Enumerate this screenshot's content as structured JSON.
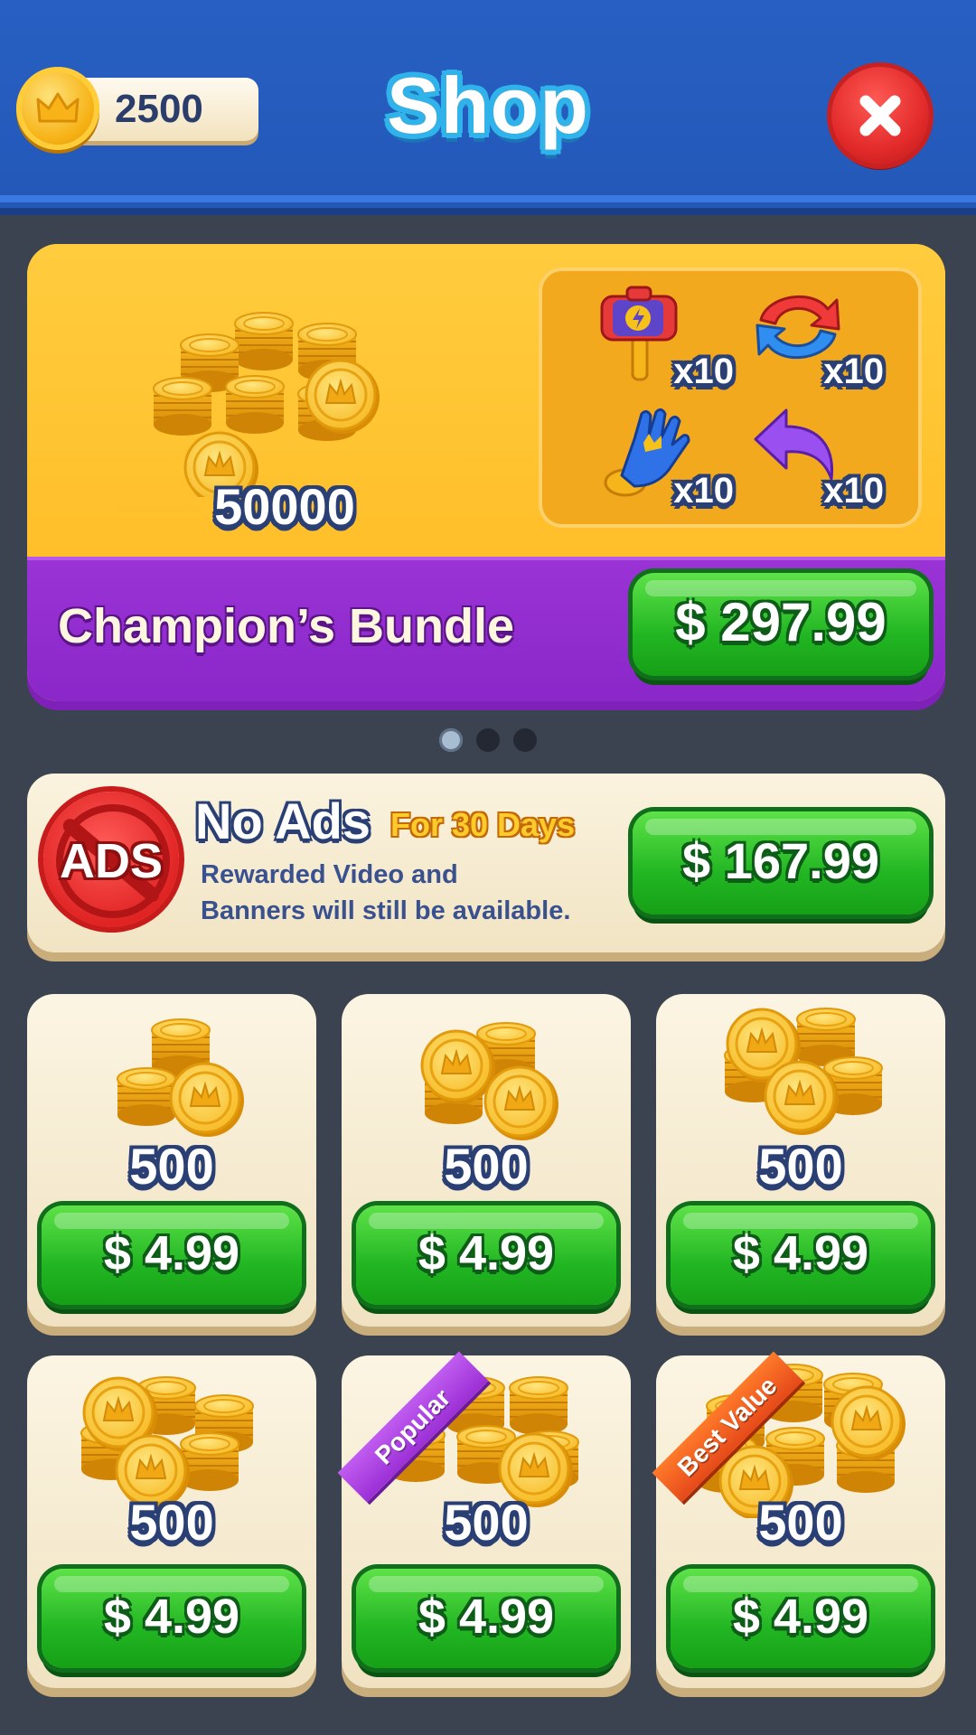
{
  "header": {
    "title": "Shop",
    "coin_balance": "2500",
    "close_icon": "close-icon",
    "coin_icon": "crown-coin-icon"
  },
  "bundle": {
    "name": "Champion’s Bundle",
    "coin_amount": "50000",
    "price": "$ 297.99",
    "boosters": [
      {
        "icon": "hammer-icon",
        "qty": "x10"
      },
      {
        "icon": "shuffle-icon",
        "qty": "x10"
      },
      {
        "icon": "glove-icon",
        "qty": "x10"
      },
      {
        "icon": "undo-icon",
        "qty": "x10"
      }
    ]
  },
  "pager": {
    "count": 3,
    "active_index": 0
  },
  "no_ads": {
    "badge": "ADS",
    "title": "No Ads",
    "subtitle": "For 30 Days",
    "description_line1": "Rewarded Video and",
    "description_line2": "Banners will still be available.",
    "price": "$ 167.99"
  },
  "packs": [
    {
      "amount": "500",
      "price": "$ 4.99",
      "ribbon": ""
    },
    {
      "amount": "500",
      "price": "$ 4.99",
      "ribbon": ""
    },
    {
      "amount": "500",
      "price": "$ 4.99",
      "ribbon": ""
    },
    {
      "amount": "500",
      "price": "$ 4.99",
      "ribbon": ""
    },
    {
      "amount": "500",
      "price": "$ 4.99",
      "ribbon": "Popular"
    },
    {
      "amount": "500",
      "price": "$ 4.99",
      "ribbon": "Best Value"
    }
  ],
  "colors": {
    "header_blue": "#2760c2",
    "background": "#3c4350",
    "bundle_yellow": "#ffc531",
    "bundle_purple": "#8a27c8",
    "button_green": "#22b623",
    "card_cream": "#f6ecd2",
    "ribbon_popular": "#9b2fd6",
    "ribbon_best_value": "#e5491a"
  }
}
